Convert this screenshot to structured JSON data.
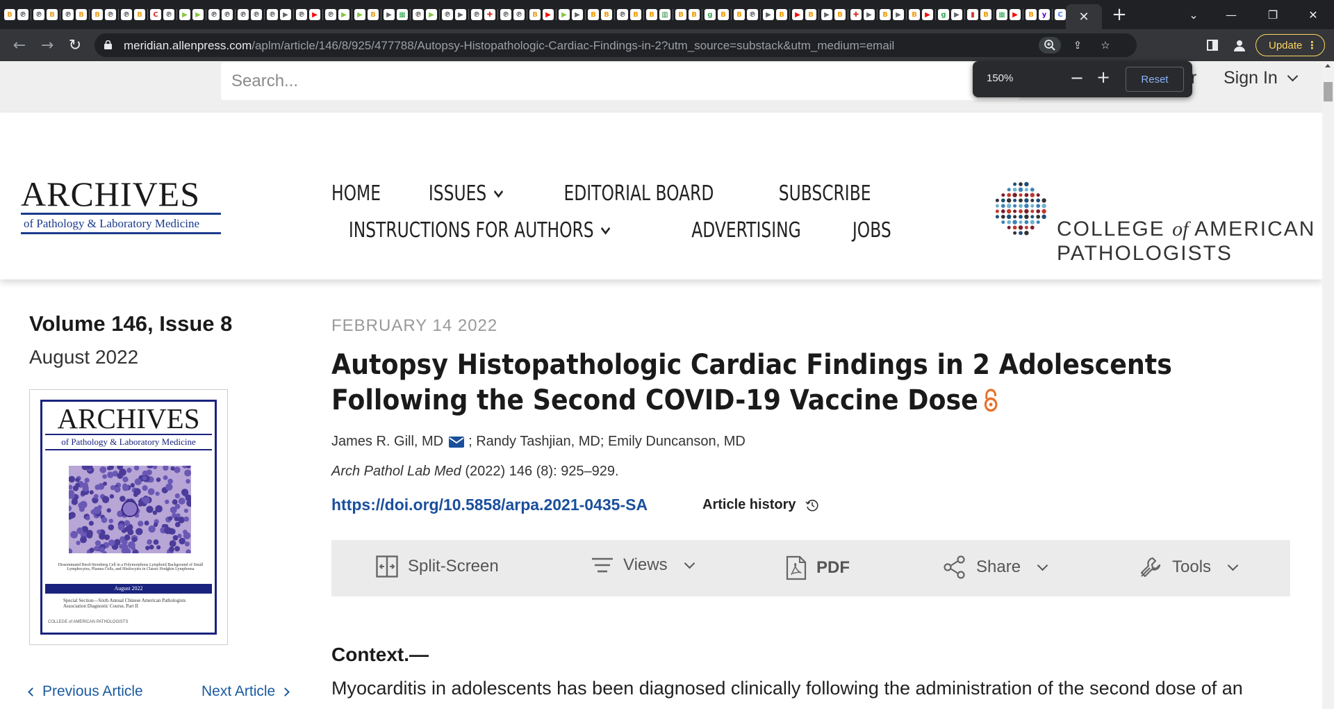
{
  "browser": {
    "url_host": "meridian.allenpress.com",
    "url_path": "/aplm/article/146/8/925/477788/Autopsy-Histopathologic-Cardiac-Findings-in-2?utm_source=substack&utm_medium=email",
    "update_label": "Update",
    "tab_favicons": [
      {
        "icon": "blog-favicon-icon",
        "glyph": "B",
        "color": "#e8a020"
      },
      {
        "icon": "p-favicon-icon",
        "glyph": "℗",
        "color": "#555555"
      },
      {
        "icon": "p-favicon-icon",
        "glyph": "℗",
        "color": "#555555"
      },
      {
        "icon": "blog-favicon-icon",
        "glyph": "B",
        "color": "#e8a020"
      },
      {
        "icon": "p-favicon-icon",
        "glyph": "℗",
        "color": "#555555"
      },
      {
        "icon": "blog-favicon-icon",
        "glyph": "B",
        "color": "#e8a020"
      },
      {
        "icon": "blog-favicon-icon",
        "glyph": "B",
        "color": "#e8a020"
      },
      {
        "icon": "p-favicon-icon",
        "glyph": "℗",
        "color": "#555555"
      },
      {
        "icon": "p-favicon-icon",
        "glyph": "℗",
        "color": "#555555"
      },
      {
        "icon": "blog-favicon-icon",
        "glyph": "B",
        "color": "#e8a020"
      },
      {
        "icon": "red-c-favicon-icon",
        "glyph": "C",
        "color": "#d93025"
      },
      {
        "icon": "p-favicon-icon",
        "glyph": "℗",
        "color": "#555555"
      },
      {
        "icon": "rumble-favicon-icon",
        "glyph": "▶",
        "color": "#85c742"
      },
      {
        "icon": "rumble-favicon-icon",
        "glyph": "▶",
        "color": "#85c742"
      },
      {
        "icon": "p-favicon-icon",
        "glyph": "℗",
        "color": "#555555"
      },
      {
        "icon": "p-favicon-icon",
        "glyph": "℗",
        "color": "#555555"
      },
      {
        "icon": "p-favicon-icon",
        "glyph": "℗",
        "color": "#555555"
      },
      {
        "icon": "p-favicon-icon",
        "glyph": "℗",
        "color": "#555555"
      },
      {
        "icon": "p-favicon-icon",
        "glyph": "℗",
        "color": "#555555"
      },
      {
        "icon": "play-favicon-icon",
        "glyph": "▶",
        "color": "#5f6368"
      },
      {
        "icon": "p-favicon-icon",
        "glyph": "℗",
        "color": "#555555"
      },
      {
        "icon": "youtube-favicon-icon",
        "glyph": "▶",
        "color": "#ff0000"
      },
      {
        "icon": "p-favicon-icon",
        "glyph": "℗",
        "color": "#555555"
      },
      {
        "icon": "rumble-favicon-icon",
        "glyph": "▶",
        "color": "#85c742"
      },
      {
        "icon": "rumble-favicon-icon",
        "glyph": "▶",
        "color": "#85c742"
      },
      {
        "icon": "blog-favicon-icon",
        "glyph": "B",
        "color": "#e8a020"
      },
      {
        "icon": "play-favicon-icon",
        "glyph": "▶",
        "color": "#5f6368"
      },
      {
        "icon": "doc-favicon-icon",
        "glyph": "▦",
        "color": "#34a853"
      },
      {
        "icon": "p-favicon-icon",
        "glyph": "℗",
        "color": "#555555"
      },
      {
        "icon": "rumble-favicon-icon",
        "glyph": "▶",
        "color": "#85c742"
      },
      {
        "icon": "p-favicon-icon",
        "glyph": "℗",
        "color": "#555555"
      },
      {
        "icon": "play-favicon-icon",
        "glyph": "▶",
        "color": "#5f6368"
      },
      {
        "icon": "p-favicon-icon",
        "glyph": "℗",
        "color": "#555555"
      },
      {
        "icon": "red-mark-favicon-icon",
        "glyph": "✚",
        "color": "#d93025"
      },
      {
        "icon": "p-favicon-icon",
        "glyph": "℗",
        "color": "#555555"
      },
      {
        "icon": "p-favicon-icon",
        "glyph": "℗",
        "color": "#555555"
      },
      {
        "icon": "blog-favicon-icon",
        "glyph": "B",
        "color": "#e8a020"
      },
      {
        "icon": "youtube-favicon-icon",
        "glyph": "▶",
        "color": "#ff0000"
      },
      {
        "icon": "rumble-favicon-icon",
        "glyph": "▶",
        "color": "#85c742"
      },
      {
        "icon": "play-favicon-icon",
        "glyph": "▶",
        "color": "#5f6368"
      },
      {
        "icon": "b3-favicon-icon",
        "glyph": "B",
        "color": "#f29900"
      },
      {
        "icon": "b3-favicon-icon",
        "glyph": "B",
        "color": "#f29900"
      },
      {
        "icon": "p-favicon-icon",
        "glyph": "℗",
        "color": "#555555"
      },
      {
        "icon": "b3-favicon-icon",
        "glyph": "B",
        "color": "#f29900"
      },
      {
        "icon": "b3-favicon-icon",
        "glyph": "B",
        "color": "#f29900"
      },
      {
        "icon": "doc-favicon-icon",
        "glyph": "▥",
        "color": "#1e8e3e"
      },
      {
        "icon": "b3-favicon-icon",
        "glyph": "B",
        "color": "#f29900"
      },
      {
        "icon": "b3-favicon-icon",
        "glyph": "B",
        "color": "#f29900"
      },
      {
        "icon": "g-favicon-icon",
        "glyph": "g",
        "color": "#34a853"
      },
      {
        "icon": "b3-favicon-icon",
        "glyph": "B",
        "color": "#f29900"
      },
      {
        "icon": "b3-favicon-icon",
        "glyph": "B",
        "color": "#f29900"
      },
      {
        "icon": "p-favicon-icon",
        "glyph": "℗",
        "color": "#555555"
      },
      {
        "icon": "play-favicon-icon",
        "glyph": "▶",
        "color": "#5f6368"
      },
      {
        "icon": "b3-favicon-icon",
        "glyph": "B",
        "color": "#f29900"
      },
      {
        "icon": "youtube-favicon-icon",
        "glyph": "▶",
        "color": "#ff0000"
      },
      {
        "icon": "b3-favicon-icon",
        "glyph": "B",
        "color": "#f29900"
      },
      {
        "icon": "play-favicon-icon",
        "glyph": "▶",
        "color": "#5f6368"
      },
      {
        "icon": "b3-favicon-icon",
        "glyph": "B",
        "color": "#f29900"
      },
      {
        "icon": "red-mark-favicon-icon",
        "glyph": "✚",
        "color": "#d93025"
      },
      {
        "icon": "play-favicon-icon",
        "glyph": "▶",
        "color": "#5f6368"
      },
      {
        "icon": "b3-favicon-icon",
        "glyph": "B",
        "color": "#f29900"
      },
      {
        "icon": "play-favicon-icon",
        "glyph": "▶",
        "color": "#5f6368"
      },
      {
        "icon": "b3-favicon-icon",
        "glyph": "B",
        "color": "#f29900"
      },
      {
        "icon": "youtube-favicon-icon",
        "glyph": "▶",
        "color": "#ff0000"
      },
      {
        "icon": "g-favicon-icon",
        "glyph": "g",
        "color": "#34a853"
      },
      {
        "icon": "play-favicon-icon",
        "glyph": "▶",
        "color": "#5f6368"
      },
      {
        "icon": "red-mark-favicon-icon",
        "glyph": "▮",
        "color": "#d93025"
      },
      {
        "icon": "b3-favicon-icon",
        "glyph": "B",
        "color": "#f29900"
      },
      {
        "icon": "doc-favicon-icon",
        "glyph": "▦",
        "color": "#34a853"
      },
      {
        "icon": "youtube-favicon-icon",
        "glyph": "▶",
        "color": "#ff0000"
      },
      {
        "icon": "b3-favicon-icon",
        "glyph": "B",
        "color": "#f29900"
      },
      {
        "icon": "yahoo-favicon-icon",
        "glyph": "y",
        "color": "#6001d2"
      },
      {
        "icon": "c-favicon-icon",
        "glyph": "C",
        "color": "#4285f4"
      },
      {
        "icon": "doc-favicon-icon",
        "glyph": "▥",
        "color": "#1e8e3e"
      },
      {
        "icon": "doc-favicon-icon",
        "glyph": "▤",
        "color": "#5f6368"
      },
      {
        "icon": "doc-favicon-icon",
        "glyph": "▦",
        "color": "#4285f4"
      },
      {
        "icon": "doc-favicon-icon",
        "glyph": "▤",
        "color": "#f29900"
      },
      {
        "icon": "p-favicon-icon",
        "glyph": "⁝",
        "color": "#f29900"
      },
      {
        "icon": "tr-favicon-icon",
        "glyph": "T",
        "color": "#333333"
      },
      {
        "icon": "slash-favicon-icon",
        "glyph": "⁄",
        "color": "#5f6368"
      },
      {
        "icon": "yahoo-favicon-icon",
        "glyph": "y",
        "color": "#6001d2"
      },
      {
        "icon": "yahoo-mail-favicon-icon",
        "glyph": "✉",
        "color": "#6001d2"
      }
    ]
  },
  "zoom_popup": {
    "level": "150%",
    "minus": "−",
    "plus": "+",
    "reset": "Reset"
  },
  "site": {
    "search_placeholder": "Search...",
    "register_fragment": "er",
    "signin": "Sign In",
    "journal_logo": {
      "big": "ARCHIVES",
      "sub": "of Pathology & Laboratory Medicine"
    },
    "nav_row1": [
      {
        "label": "HOME",
        "dropdown": false
      },
      {
        "label": "ISSUES",
        "dropdown": true
      },
      {
        "label": "EDITORIAL BOARD",
        "dropdown": false
      },
      {
        "label": "SUBSCRIBE",
        "dropdown": false
      }
    ],
    "nav_row2": [
      {
        "label": "INSTRUCTIONS FOR AUTHORS",
        "dropdown": true
      },
      {
        "label": "ADVERTISING",
        "dropdown": false
      },
      {
        "label": "JOBS",
        "dropdown": false
      }
    ],
    "cap_logo": {
      "line1_a": "COLLEGE ",
      "line1_of": "of",
      "line1_b": " AMERICAN",
      "line2": "PATHOLOGISTS"
    }
  },
  "sidebar": {
    "volume": "Volume 146, Issue 8",
    "month": "August 2022",
    "cover": {
      "big": "ARCHIVES",
      "sub": "of Pathology & Laboratory Medicine",
      "caption": "Disseminated Reed-Sternberg Cell in a Polymorphous Lymphoid Background of Small Lymphocytes, Plasma Cells, and Histiocytes in Classic Hodgkin Lymphoma",
      "date": "August 2022",
      "special": "Special Section—Sixth Annual Chinese American Pathologists Association Diagnostic Course, Part II",
      "cap": "COLLEGE of AMERICAN PATHOLOGISTS"
    },
    "prev": "Previous Article",
    "next": "Next Article"
  },
  "article": {
    "date": "FEBRUARY 14 2022",
    "title": "Autopsy Histopathologic Cardiac Findings in 2 Adolescents Following the Second COVID-19 Vaccine Dose",
    "author1": "James R. Gill, MD",
    "authors_rest": "; Randy Tashjian, MD; Emily Duncanson, MD",
    "journal_abbr": "Arch Pathol Lab Med",
    "citation_rest": " (2022) 146 (8): 925–929.",
    "doi": "https://doi.org/10.5858/arpa.2021-0435-SA",
    "history": "Article history",
    "toolbar": {
      "split": "Split-Screen",
      "views": "Views",
      "pdf": "PDF",
      "share": "Share",
      "tools": "Tools"
    },
    "context_heading": "Context.—",
    "context_text": "Myocarditis in adolescents has been diagnosed clinically following the administration of the second dose of an"
  },
  "colors": {
    "link": "#1a4f9c",
    "accent_orange": "#e8702a",
    "journal_blue": "#1a3a8c"
  }
}
